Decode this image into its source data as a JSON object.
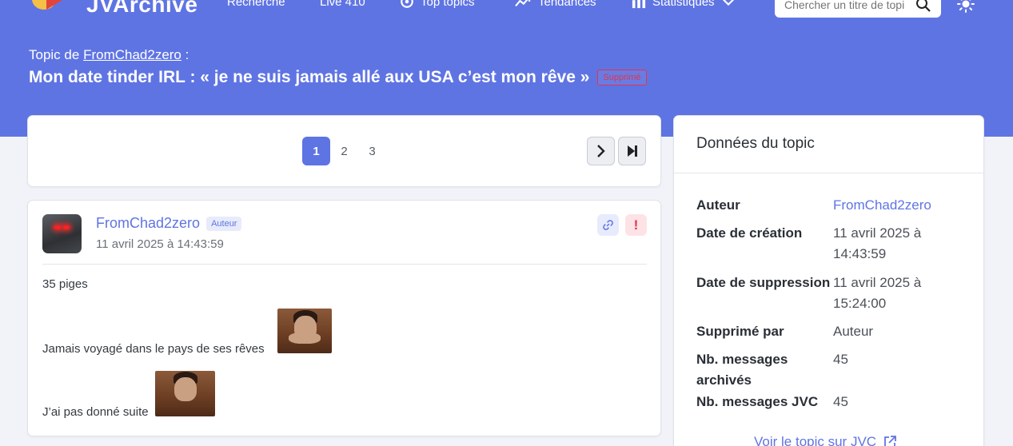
{
  "navbar": {
    "brand": "JVArchive",
    "items": [
      {
        "label": "Recherche",
        "icon": "search-nav-icon"
      },
      {
        "label": "Live 410",
        "icon": "live-icon"
      },
      {
        "label": "Top topics",
        "icon": "top-topics-icon"
      },
      {
        "label": "Tendances",
        "icon": "trend-icon"
      },
      {
        "label": "Statistiques",
        "icon": "stats-icon"
      }
    ],
    "search_placeholder": "Chercher un titre de topic",
    "theme_icon": "sun-icon"
  },
  "topic": {
    "by_prefix": "Topic de",
    "by_author": "FromChad2zero",
    "by_suffix": ":",
    "title": "Mon date tinder IRL : « je ne suis jamais allé aux USA c’est mon rêve »",
    "status_badge": "Supprimé"
  },
  "pagination": {
    "pages": [
      "1",
      "2",
      "3"
    ],
    "current": "1"
  },
  "message": {
    "author": "FromChad2zero",
    "author_badge": "Auteur",
    "date": "11 avril 2025 à 14:43:59",
    "lines": [
      "35 piges",
      "Jamais voyagé dans le pays de ses rêves",
      "J’ai pas donné suite"
    ],
    "report_symbol": "!"
  },
  "sidebar": {
    "title": "Données du topic",
    "rows": [
      {
        "key": "Auteur",
        "value": "FromChad2zero"
      },
      {
        "key": "Date de création",
        "value": "11 avril 2025 à 14:43:59"
      },
      {
        "key": "Date de suppression",
        "value": "11 avril 2025 à 15:24:00"
      },
      {
        "key": "Supprimé par",
        "value": "Auteur"
      },
      {
        "key": "Nb. messages archivés",
        "value": "45"
      },
      {
        "key": "Nb. messages JVC",
        "value": "45"
      }
    ],
    "link": "Voir le topic sur JVC"
  },
  "colors": {
    "accent": "#5f74e3",
    "danger": "#e3344b",
    "background": "#f1f3f8"
  }
}
